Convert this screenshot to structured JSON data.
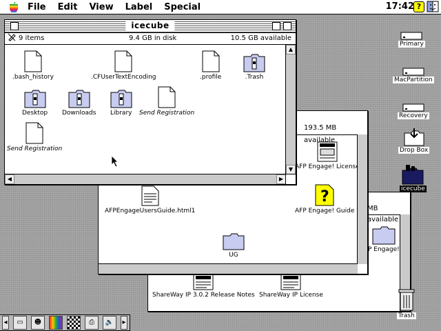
{
  "menubar": {
    "items": [
      "File",
      "Edit",
      "View",
      "Label",
      "Special"
    ],
    "clock": "17:42",
    "help": "?"
  },
  "win_front": {
    "title": "icecube",
    "items_count": "9 items",
    "disk_used": "9.4 GB in disk",
    "available": "10.5 GB available",
    "icons": [
      {
        "label": ".bash_history",
        "kind": "document"
      },
      {
        "label": ".CFUserTextEncoding",
        "kind": "document"
      },
      {
        "label": ".profile",
        "kind": "document"
      },
      {
        "label": ".Trash",
        "kind": "folder-locked"
      },
      {
        "label": "Desktop",
        "kind": "folder-locked"
      },
      {
        "label": "Downloads",
        "kind": "folder-locked"
      },
      {
        "label": "Library",
        "kind": "folder-locked"
      },
      {
        "label": "Send Registration",
        "kind": "document"
      },
      {
        "label": "Send Registration",
        "kind": "document"
      }
    ]
  },
  "win_mid": {
    "available": "193.5 MB available",
    "icons": [
      {
        "label": "AFP Engage! License",
        "kind": "license"
      },
      {
        "label": "AFPEngageUsersGuide.html1",
        "kind": "html-doc"
      },
      {
        "label": "AFP Engage! Guide",
        "kind": "guide"
      },
      {
        "label": "UG",
        "kind": "folder"
      }
    ]
  },
  "win_back": {
    "available": "MB available",
    "icons": [
      {
        "label": "P Engage!",
        "kind": "folder"
      },
      {
        "label": "ShareWay IP 3.0.2 Release Notes",
        "kind": "license"
      },
      {
        "label": "ShareWay IP License",
        "kind": "license"
      }
    ]
  },
  "desktop": {
    "icons": [
      {
        "label": "Primary",
        "kind": "disk"
      },
      {
        "label": "MacPartition",
        "kind": "disk"
      },
      {
        "label": "Recovery",
        "kind": "disk"
      },
      {
        "label": "Drop Box",
        "kind": "dropbox"
      },
      {
        "label": "icecube",
        "kind": "server-folder"
      },
      {
        "label": "Trash",
        "kind": "trash"
      }
    ]
  },
  "control_strip": {
    "items": [
      "monitor-icon",
      "file-sharing-icon",
      "color-depth-icon",
      "resolution-icon",
      "printer-icon",
      "sound-icon"
    ]
  }
}
